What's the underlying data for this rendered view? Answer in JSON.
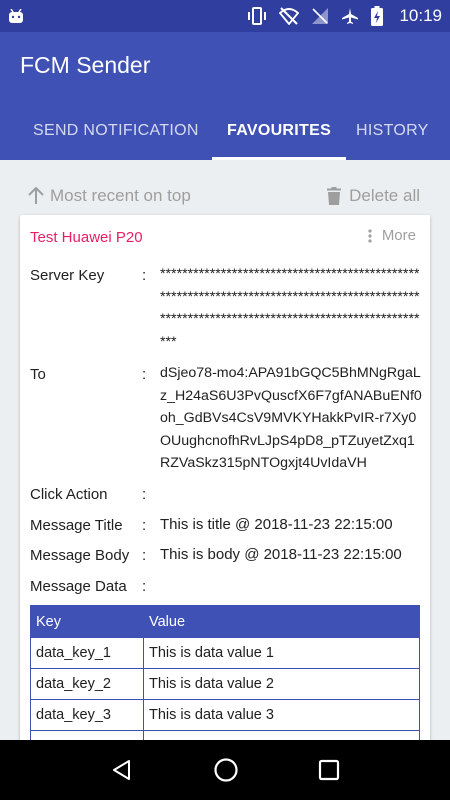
{
  "status_bar": {
    "time": "10:19",
    "icons": [
      "android-icon",
      "vibrate-icon",
      "no-wifi-icon",
      "signal-off-icon",
      "airplane-icon",
      "battery-charging-icon"
    ]
  },
  "app": {
    "title": "FCM Sender",
    "colors": {
      "primary": "#3F51B5",
      "primary_dark": "#303F9F",
      "accent": "#E91E63"
    }
  },
  "tabs": [
    {
      "label": "SEND NOTIFICATION",
      "active": false
    },
    {
      "label": "FAVOURITES",
      "active": true
    },
    {
      "label": "HISTORY",
      "active": false
    }
  ],
  "toolbar": {
    "sort_label": "Most recent on top",
    "delete_label": "Delete all"
  },
  "card": {
    "title": "Test Huawei P20",
    "more_label": "More",
    "fields": {
      "server_key": {
        "label": "Server Key",
        "value": "************************************************************************************************************************************************"
      },
      "to": {
        "label": "To",
        "value": "dSjeo78-mo4:APA91bGQC5BhMNgRgaLz_H24aS6U3PvQuscfX6F7gfANABuENf0oh_GdBVs4CsV9MVKYHakkPvIR-r7Xy0OUughcnofhRvLJpS4pD8_pTZuyetZxq1RZVaSkz315pNTOgxjt4UvIdaVH"
      },
      "click_action": {
        "label": "Click Action",
        "value": ""
      },
      "message_title": {
        "label": "Message Title",
        "value": "This is title @ 2018-11-23 22:15:00"
      },
      "message_body": {
        "label": "Message Body",
        "value": "This is body @ 2018-11-23 22:15:00"
      },
      "message_data": {
        "label": "Message Data",
        "value": ""
      }
    },
    "colon": ":",
    "table": {
      "headers": [
        "Key",
        "Value"
      ],
      "rows": [
        [
          "data_key_1",
          "This is data value 1"
        ],
        [
          "data_key_2",
          "This is data value 2"
        ],
        [
          "data_key_3",
          "This is data value 3"
        ],
        [
          "",
          ""
        ]
      ]
    }
  },
  "nav_bar": {
    "buttons": [
      "back-icon",
      "home-icon",
      "recents-icon"
    ]
  }
}
